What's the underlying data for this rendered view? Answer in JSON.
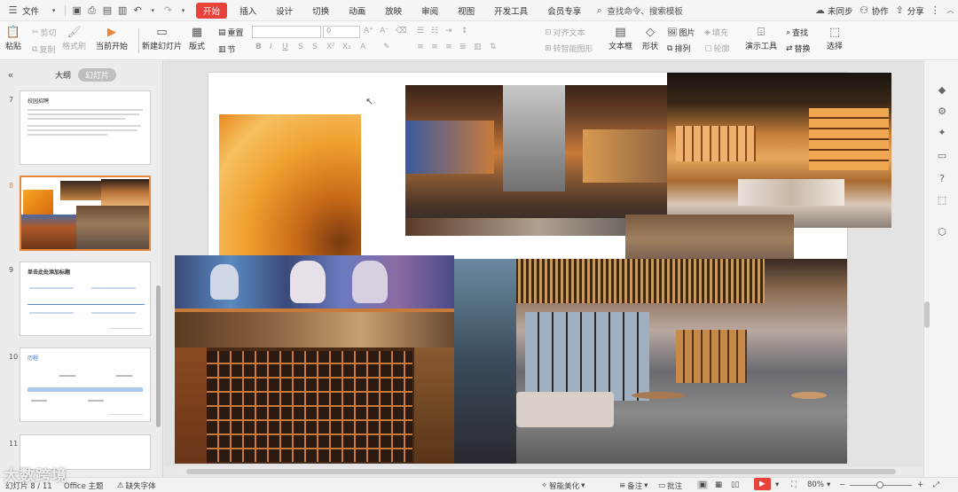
{
  "menu": {
    "file": "文件",
    "tabs": [
      "开始",
      "插入",
      "设计",
      "切换",
      "动画",
      "放映",
      "审阅",
      "视图",
      "开发工具",
      "会员专享"
    ],
    "search_placeholder": "查找命令、搜索模板",
    "sync": "未同步",
    "collab": "协作",
    "share": "分享"
  },
  "ribbon": {
    "paste": "粘贴",
    "cut": "剪切",
    "copy": "复制",
    "format_painter": "格式刷",
    "play_from_current": "当前开始",
    "new_slide": "新建幻灯片",
    "layout": "版式",
    "section": "节",
    "reset": "重置",
    "font_size": "0",
    "align_text": "对齐文本",
    "convert_smartart": "转智能图形",
    "textbox": "文本框",
    "shape": "形状",
    "picture": "图片",
    "fill": "填充",
    "arrange": "排列",
    "outline": "轮廓",
    "presenter_tools": "演示工具",
    "find": "查找",
    "replace": "替换",
    "select": "选择"
  },
  "panel": {
    "tab_outline": "大纲",
    "tab_slides": "幻灯片"
  },
  "slides": [
    {
      "num": "7",
      "title": "校园招聘"
    },
    {
      "num": "8",
      "title": ""
    },
    {
      "num": "9",
      "title": "单击此处添加标题"
    },
    {
      "num": "10",
      "title": "历程"
    },
    {
      "num": "11",
      "title": ""
    }
  ],
  "status": {
    "page": "幻灯片 8 / 11",
    "theme": "Office 主题",
    "missing_font": "缺失字体",
    "beautify": "智能美化",
    "notes": "备注",
    "comment": "批注",
    "zoom": "80%"
  },
  "watermark": "大数跨境",
  "colors": {
    "accent": "#e8433a",
    "selected_thumb": "#e8873a",
    "play": "#e8433a"
  }
}
